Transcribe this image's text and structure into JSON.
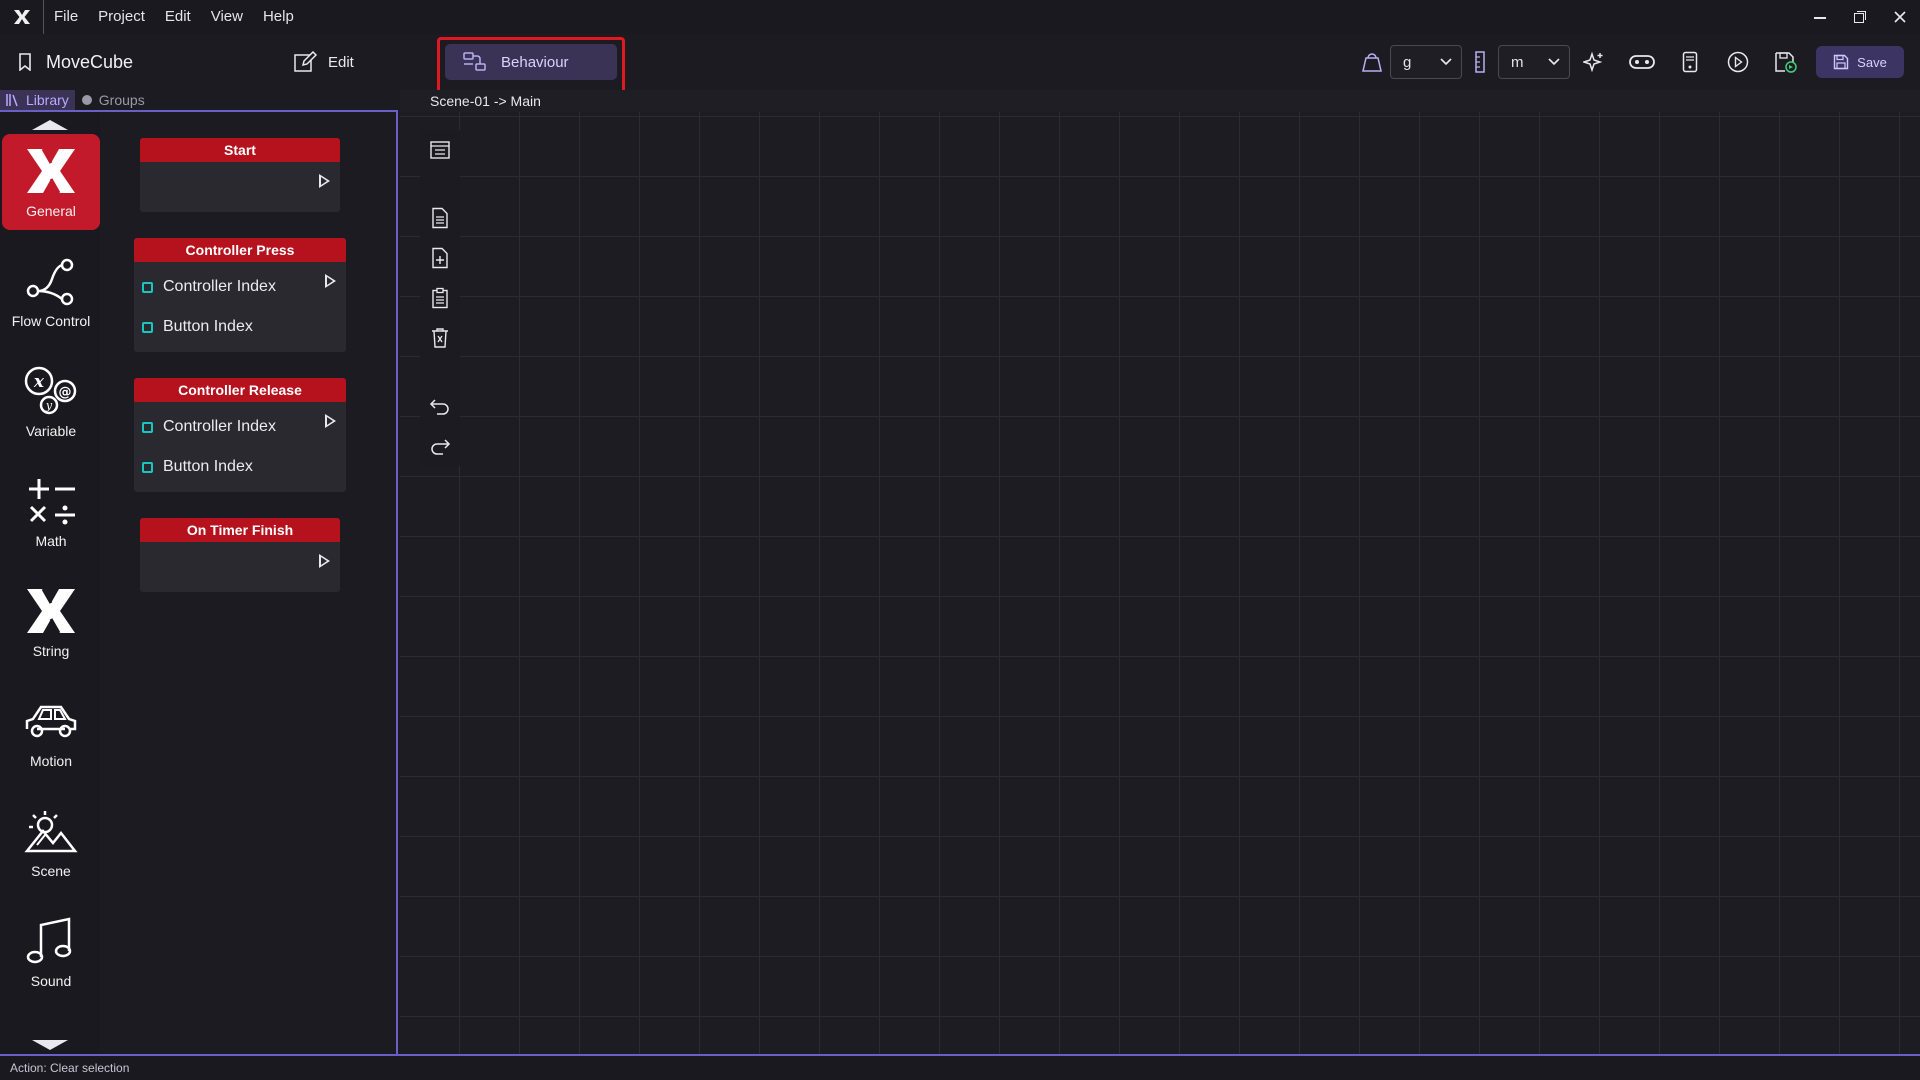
{
  "menubar": {
    "items": [
      "File",
      "Project",
      "Edit",
      "View",
      "Help"
    ]
  },
  "toolbar": {
    "project_name": "MoveCube",
    "edit_label": "Edit",
    "behaviour_label": "Behaviour",
    "mass_unit": "g",
    "length_unit": "m",
    "save_label": "Save"
  },
  "library_tabs": {
    "library": "Library",
    "groups": "Groups"
  },
  "categories": [
    {
      "label": "General",
      "icon": "general-icon",
      "active": true
    },
    {
      "label": "Flow Control",
      "icon": "flow-control-icon"
    },
    {
      "label": "Variable",
      "icon": "variable-icon"
    },
    {
      "label": "Math",
      "icon": "math-icon"
    },
    {
      "label": "String",
      "icon": "string-icon"
    },
    {
      "label": "Motion",
      "icon": "car-icon"
    },
    {
      "label": "Scene",
      "icon": "scene-icon"
    },
    {
      "label": "Sound",
      "icon": "music-note-icon"
    }
  ],
  "nodes": [
    {
      "title": "Start",
      "ports": []
    },
    {
      "title": "Controller Press",
      "ports": [
        "Controller Index",
        "Button Index"
      ]
    },
    {
      "title": "Controller Release",
      "ports": [
        "Controller Index",
        "Button Index"
      ]
    },
    {
      "title": "On Timer Finish",
      "ports": []
    }
  ],
  "canvas": {
    "breadcrumb": "Scene-01 -> Main"
  },
  "status": {
    "text": "Action: Clear selection"
  },
  "colors": {
    "accent": "#6a5fc4",
    "node_header": "#b5121e",
    "active_category": "#c21a2a",
    "port": "#19c7c2"
  }
}
